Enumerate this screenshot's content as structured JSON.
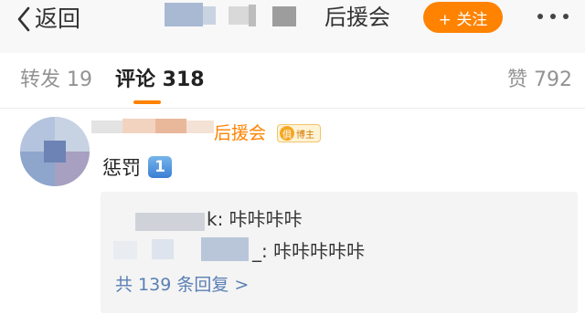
{
  "navbar": {
    "back_label": "返回",
    "group_name": "后援会",
    "follow_label": "+ 关注"
  },
  "tabs": {
    "repost": "转发 19",
    "comments": "评论 318",
    "likes": "赞 792"
  },
  "comment": {
    "user_suffix": "后援会",
    "badge_icon": "俱",
    "badge_label": "博主",
    "text": "惩罚",
    "number_emoji": "1",
    "replies": [
      {
        "tail": "k: 咔咔咔咔"
      },
      {
        "tail": "_: 咔咔咔咔咔"
      }
    ],
    "reply_count": "共 139 条回复 >"
  },
  "colors": {
    "accent": "#ff8200",
    "link": "#5a7fb4",
    "reply_bg": "#f4f4f4",
    "nav_bg": "#f8f8f8"
  },
  "icons": {
    "back": "chevron-left-icon",
    "more": "more-dots-icon",
    "badge": "fan-badge-icon"
  }
}
